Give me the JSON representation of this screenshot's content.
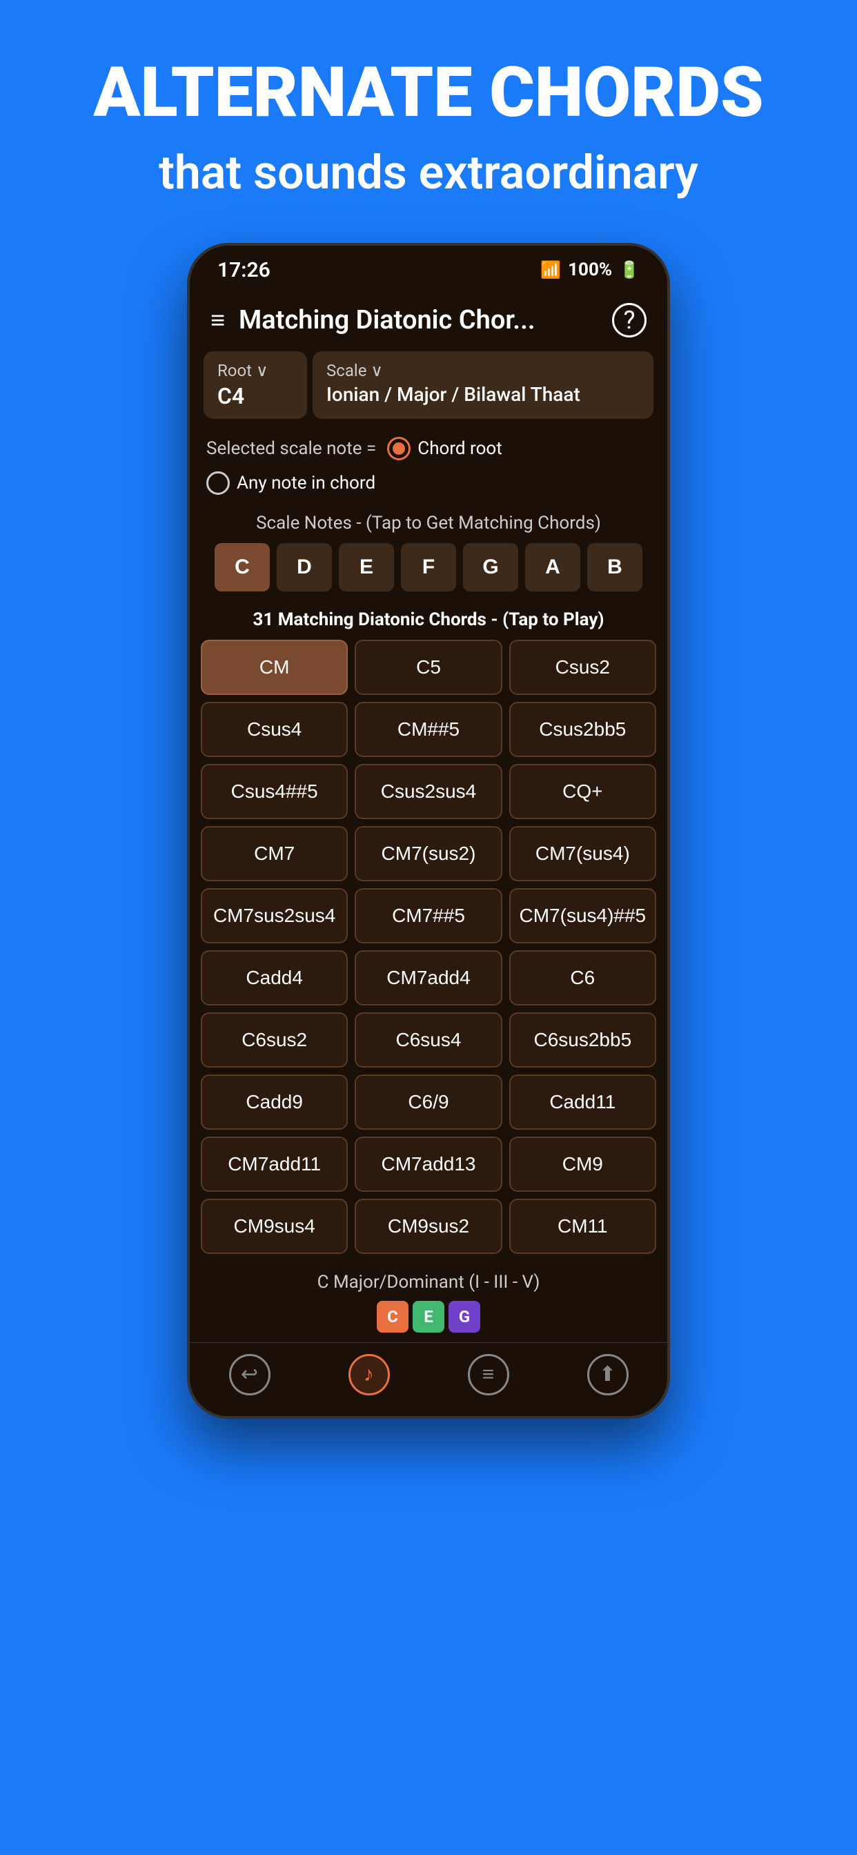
{
  "hero": {
    "title": "ALTERNATE CHORDS",
    "subtitle": "that sounds extraordinary"
  },
  "status_bar": {
    "time": "17:26",
    "battery": "100%",
    "signal": "WiFi + LTE"
  },
  "app": {
    "title": "Matching Diatonic Chor...",
    "hamburger_label": "≡",
    "help_label": "?"
  },
  "root_selector": {
    "label": "Root ∨",
    "value": "C4"
  },
  "scale_selector": {
    "label": "Scale ∨",
    "value": "Ionian / Major / Bilawal Thaat"
  },
  "radio": {
    "prefix": "Selected scale note =",
    "option1": "Chord root",
    "option2": "Any note in chord"
  },
  "scale_notes": {
    "label": "Scale Notes - (Tap to Get Matching Chords)",
    "notes": [
      "C",
      "D",
      "E",
      "F",
      "G",
      "A",
      "B"
    ],
    "active": "C"
  },
  "matching_chords": {
    "label_prefix": "31",
    "label_suffix": " Matching Diatonic Chords - (Tap to Play)",
    "chords": [
      "CM",
      "C5",
      "Csus2",
      "Csus4",
      "CM##5",
      "Csus2bb5",
      "Csus4##5",
      "Csus2sus4",
      "CQ+",
      "CM7",
      "CM7(sus2)",
      "CM7(sus4)",
      "CM7sus2sus4",
      "CM7##5",
      "CM7(sus4)##5",
      "Cadd4",
      "CM7add4",
      "C6",
      "C6sus2",
      "C6sus4",
      "C6sus2bb5",
      "Cadd9",
      "C6/9",
      "Cadd11",
      "CM7add11",
      "CM7add13",
      "CM9",
      "CM9sus4",
      "CM9sus2",
      "CM11"
    ],
    "highlight": "CM"
  },
  "chord_info": {
    "label": "C Major/Dominant (I - III - V)",
    "notes": [
      {
        "note": "C",
        "color": "chip-c"
      },
      {
        "note": "E",
        "color": "chip-e"
      },
      {
        "note": "G",
        "color": "chip-g"
      }
    ]
  },
  "bottom_nav": {
    "items": [
      "↩",
      "♪",
      "≡",
      "⬆"
    ]
  }
}
